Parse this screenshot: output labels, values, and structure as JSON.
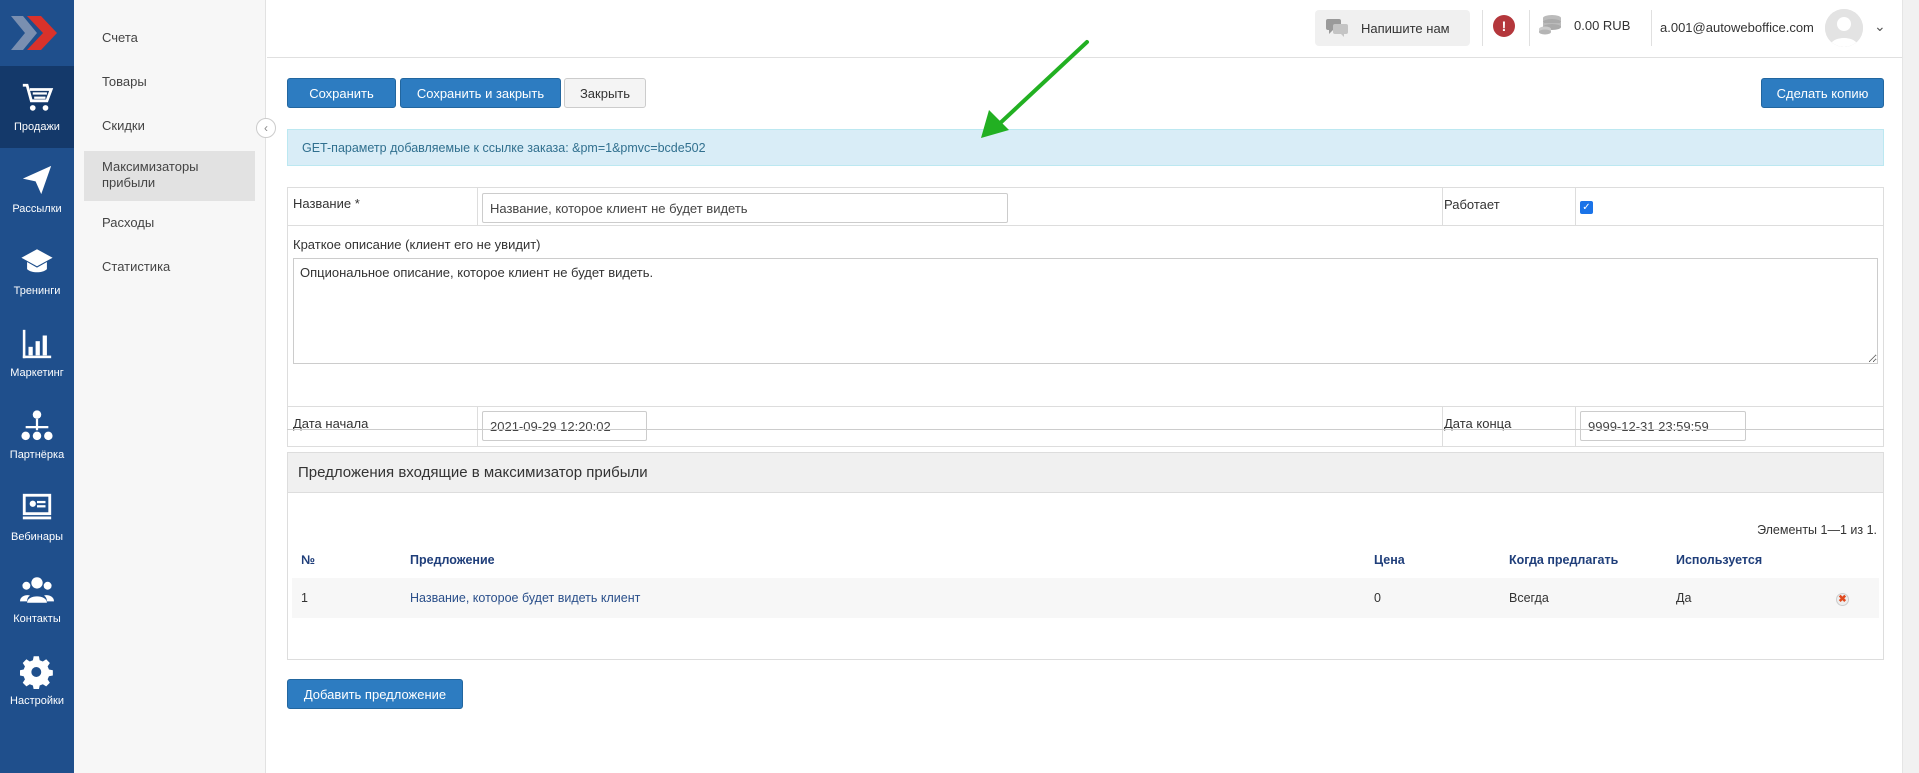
{
  "rail": {
    "items": [
      {
        "label": "Продажи",
        "icon": "cart-icon",
        "active": true
      },
      {
        "label": "Рассылки",
        "icon": "paper-plane-icon"
      },
      {
        "label": "Тренинги",
        "icon": "graduation-cap-icon"
      },
      {
        "label": "Маркетинг",
        "icon": "bar-chart-icon"
      },
      {
        "label": "Партнёрка",
        "icon": "network-icon"
      },
      {
        "label": "Вебинары",
        "icon": "presentation-icon"
      },
      {
        "label": "Контакты",
        "icon": "users-icon"
      },
      {
        "label": "Настройки",
        "icon": "gear-icon"
      }
    ]
  },
  "subnav": {
    "items": [
      {
        "label": "Счета"
      },
      {
        "label": "Товары"
      },
      {
        "label": "Скидки"
      },
      {
        "label": "Максимизаторы прибыли",
        "active": true
      },
      {
        "label": "Расходы"
      },
      {
        "label": "Статистика"
      }
    ]
  },
  "topbar": {
    "chat_label": "Напишите нам",
    "balance": "0.00 RUB",
    "user_email": "a.001@autoweboffice.com"
  },
  "toolbar": {
    "save": "Сохранить",
    "save_close": "Сохранить и закрыть",
    "close": "Закрыть",
    "copy": "Сделать копию"
  },
  "info": {
    "text": "GET-параметр добавляемые к ссылке заказа: &pm=1&pmvc=bcde502"
  },
  "form": {
    "name_label": "Название *",
    "name_value": "Название, которое клиент не будет видеть",
    "works_label": "Работает",
    "works_checked": true,
    "desc_label": "Краткое описание (клиент его не увидит)",
    "desc_value": "Опциональное описание, которое клиент не будет видеть.",
    "start_label": "Дата начала",
    "start_value": "2021-09-29 12:20:02",
    "end_label": "Дата конца",
    "end_value": "9999-12-31 23:59:59"
  },
  "offers": {
    "title": "Предложения входящие в максимизатор прибыли",
    "pager": "Элементы 1—1 из 1.",
    "columns": [
      "№",
      "Предложение",
      "Цена",
      "Когда предлагать",
      "Используется"
    ],
    "rows": [
      {
        "num": "1",
        "offer": "Название, которое будет видеть клиент",
        "price": "0",
        "when": "Всегда",
        "used": "Да"
      }
    ],
    "add_button": "Добавить предложение"
  },
  "colors": {
    "rail_bg": "#1f4f8c",
    "primary": "#2d7cc1",
    "info_bg": "#d9edf7",
    "arrow": "#22b022"
  }
}
